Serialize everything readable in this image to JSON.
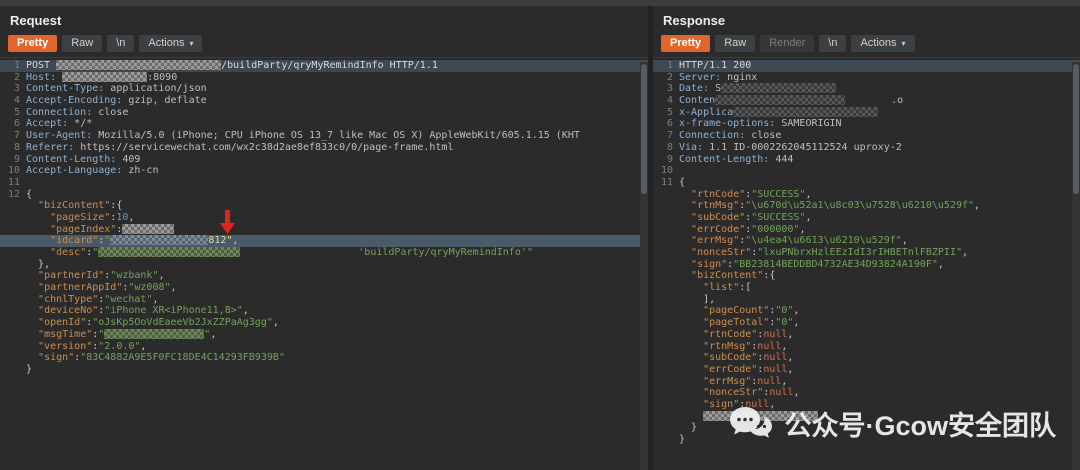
{
  "colors": {
    "accent_orange": "#e2662c",
    "selection_row": "#4b5a68",
    "caret_line": "#3e4852",
    "arrow_red": "#e0241a",
    "editor_bg": "#2b2b2b",
    "json_key": "#cd8d4e",
    "json_string": "#74a35a",
    "header_name_blue": "#8cb1d3"
  },
  "watermark": {
    "icon": "chat-bubbles-icon",
    "text": "公众号·Gcow安全团队"
  },
  "request": {
    "title": "Request",
    "tabs": [
      {
        "id": "pretty",
        "label": "Pretty",
        "selected": true
      },
      {
        "id": "raw",
        "label": "Raw"
      },
      {
        "id": "newline",
        "label": "\\n"
      },
      {
        "id": "actions",
        "label": "Actions",
        "caret": true
      }
    ],
    "lines": [
      {
        "n": "1",
        "hl": "caret",
        "seg": [
          [
            "t",
            "POST "
          ],
          [
            "R",
            165,
            "g"
          ],
          [
            "t",
            "/buildParty/qryMyRemindInfo HTTP/1.1"
          ]
        ]
      },
      {
        "n": "2",
        "seg": [
          [
            "h",
            "Host: "
          ],
          [
            "R",
            85,
            "g"
          ],
          [
            "v",
            ":8090"
          ]
        ]
      },
      {
        "n": "3",
        "seg": [
          [
            "h",
            "Content-Type: "
          ],
          [
            "v",
            "application/json"
          ]
        ]
      },
      {
        "n": "4",
        "seg": [
          [
            "h",
            "Accept-Encoding: "
          ],
          [
            "v",
            "gzip, deflate"
          ]
        ]
      },
      {
        "n": "5",
        "seg": [
          [
            "h",
            "Connection: "
          ],
          [
            "v",
            "close"
          ]
        ]
      },
      {
        "n": "6",
        "seg": [
          [
            "h",
            "Accept: "
          ],
          [
            "v",
            "*/*"
          ]
        ]
      },
      {
        "n": "7",
        "seg": [
          [
            "h",
            "User-Agent: "
          ],
          [
            "v",
            "Mozilla/5.0 (iPhone; CPU iPhone OS 13_7 like Mac OS X) AppleWebKit/605.1.15 (KHT"
          ]
        ]
      },
      {
        "n": "8",
        "seg": [
          [
            "h",
            "Referer: "
          ],
          [
            "v",
            "https://servicewechat.com/wx2c38d2ae8ef833c0/0/page-frame.html"
          ]
        ]
      },
      {
        "n": "9",
        "seg": [
          [
            "h",
            "Content-Length: "
          ],
          [
            "v",
            "409"
          ]
        ]
      },
      {
        "n": "10",
        "seg": [
          [
            "h",
            "Accept-Language: "
          ],
          [
            "v",
            "zh-cn"
          ]
        ]
      },
      {
        "n": "11",
        "seg": []
      },
      {
        "n": "12",
        "seg": [
          [
            "p",
            "{"
          ]
        ]
      },
      {
        "seg": [
          [
            "t",
            "  "
          ],
          [
            "k",
            "\"bizContent\""
          ],
          [
            "p",
            ":{"
          ]
        ]
      },
      {
        "seg": [
          [
            "t",
            "    "
          ],
          [
            "k",
            "\"pageSize\""
          ],
          [
            "p",
            ":"
          ],
          [
            "n",
            "10"
          ],
          [
            "p",
            ","
          ]
        ]
      },
      {
        "seg": [
          [
            "t",
            "    "
          ],
          [
            "k",
            "\"pageIndex\""
          ],
          [
            "p",
            ":"
          ],
          [
            "R",
            52,
            "g"
          ]
        ]
      },
      {
        "hl": "sel",
        "seg": [
          [
            "t",
            "    "
          ],
          [
            "k",
            "\"idcard\""
          ],
          [
            "p",
            ":"
          ],
          [
            "s",
            "\""
          ],
          [
            "R",
            98,
            "b"
          ],
          [
            "y",
            "812\""
          ],
          [
            "p",
            ","
          ]
        ]
      },
      {
        "seg": [
          [
            "t",
            "    "
          ],
          [
            "k",
            "\"desc\""
          ],
          [
            "p",
            ":"
          ],
          [
            "s",
            "\""
          ],
          [
            "R",
            142,
            "grn"
          ],
          [
            "S",
            118
          ],
          [
            "s",
            "'buildParty/qryMyRemindInfo'\""
          ]
        ]
      },
      {
        "seg": [
          [
            "t",
            "  "
          ],
          [
            "p",
            "},"
          ]
        ]
      },
      {
        "seg": [
          [
            "t",
            "  "
          ],
          [
            "k",
            "\"partnerId\""
          ],
          [
            "p",
            ":"
          ],
          [
            "s",
            "\"wzbank\""
          ],
          [
            "p",
            ","
          ]
        ]
      },
      {
        "seg": [
          [
            "t",
            "  "
          ],
          [
            "k",
            "\"partnerAppId\""
          ],
          [
            "p",
            ":"
          ],
          [
            "s",
            "\"wz008\""
          ],
          [
            "p",
            ","
          ]
        ]
      },
      {
        "seg": [
          [
            "t",
            "  "
          ],
          [
            "k",
            "\"chnlType\""
          ],
          [
            "p",
            ":"
          ],
          [
            "s",
            "\"wechat\""
          ],
          [
            "p",
            ","
          ]
        ]
      },
      {
        "seg": [
          [
            "t",
            "  "
          ],
          [
            "k",
            "\"deviceNo\""
          ],
          [
            "p",
            ":"
          ],
          [
            "s",
            "\"iPhone XR<iPhone11,8>\""
          ],
          [
            "p",
            ","
          ]
        ]
      },
      {
        "seg": [
          [
            "t",
            "  "
          ],
          [
            "k",
            "\"openId\""
          ],
          [
            "p",
            ":"
          ],
          [
            "s",
            "\"oJsKp5OoVdEaeeVb2JxZZPaAg3gg\""
          ],
          [
            "p",
            ","
          ]
        ]
      },
      {
        "seg": [
          [
            "t",
            "  "
          ],
          [
            "k",
            "\"msgTime\""
          ],
          [
            "p",
            ":"
          ],
          [
            "s",
            "\""
          ],
          [
            "R",
            100,
            "grn"
          ],
          [
            "s",
            "\""
          ],
          [
            "p",
            ","
          ]
        ]
      },
      {
        "seg": [
          [
            "t",
            "  "
          ],
          [
            "k",
            "\"version\""
          ],
          [
            "p",
            ":"
          ],
          [
            "s",
            "\"2.0.0\""
          ],
          [
            "p",
            ","
          ]
        ]
      },
      {
        "seg": [
          [
            "t",
            "  "
          ],
          [
            "k",
            "\"sign\""
          ],
          [
            "p",
            ":"
          ],
          [
            "s",
            "\"83C4882A9E5F0FC18DE4C14293FB939B\""
          ]
        ]
      },
      {
        "seg": [
          [
            "p",
            "}"
          ]
        ]
      }
    ]
  },
  "response": {
    "title": "Response",
    "tabs": [
      {
        "id": "pretty",
        "label": "Pretty",
        "selected": true
      },
      {
        "id": "raw",
        "label": "Raw"
      },
      {
        "id": "render",
        "label": "Render",
        "disabled": true
      },
      {
        "id": "newline",
        "label": "\\n"
      },
      {
        "id": "actions",
        "label": "Actions",
        "caret": true
      }
    ],
    "lines": [
      {
        "n": "1",
        "hl": "caret",
        "seg": [
          [
            "t",
            "HTTP/1.1 200"
          ]
        ]
      },
      {
        "n": "2",
        "seg": [
          [
            "h",
            "Server: "
          ],
          [
            "v",
            "nginx"
          ]
        ]
      },
      {
        "n": "3",
        "seg": [
          [
            "h",
            "Date: "
          ],
          [
            "v",
            "S"
          ],
          [
            "R",
            115,
            "d"
          ]
        ]
      },
      {
        "n": "4",
        "seg": [
          [
            "h",
            "Conten"
          ],
          [
            "R",
            130,
            "d"
          ],
          [
            "S",
            46
          ],
          [
            "v",
            ".o"
          ]
        ]
      },
      {
        "n": "5",
        "seg": [
          [
            "h",
            "x-Applica"
          ],
          [
            "R",
            145,
            "d"
          ]
        ]
      },
      {
        "n": "6",
        "seg": [
          [
            "h",
            "x-frame-options: "
          ],
          [
            "v",
            "SAMEORIGIN"
          ]
        ]
      },
      {
        "n": "7",
        "seg": [
          [
            "h",
            "Connection: "
          ],
          [
            "v",
            "close"
          ]
        ]
      },
      {
        "n": "8",
        "seg": [
          [
            "h",
            "Via: "
          ],
          [
            "v",
            "1.1 ID-0002262045112524 uproxy-2"
          ]
        ]
      },
      {
        "n": "9",
        "seg": [
          [
            "h",
            "Content-Length: "
          ],
          [
            "v",
            "444"
          ]
        ]
      },
      {
        "n": "10",
        "seg": []
      },
      {
        "n": "11",
        "seg": [
          [
            "p",
            "{"
          ]
        ]
      },
      {
        "seg": [
          [
            "t",
            "  "
          ],
          [
            "k",
            "\"rtnCode\""
          ],
          [
            "p",
            ":"
          ],
          [
            "s",
            "\"SUCCESS\""
          ],
          [
            "p",
            ","
          ]
        ]
      },
      {
        "seg": [
          [
            "t",
            "  "
          ],
          [
            "k",
            "\"rtnMsg\""
          ],
          [
            "p",
            ":"
          ],
          [
            "s",
            "\"\\u670d\\u52a1\\u8c03\\u7528\\u6210\\u529f\""
          ],
          [
            "p",
            ","
          ]
        ]
      },
      {
        "seg": [
          [
            "t",
            "  "
          ],
          [
            "k",
            "\"subCode\""
          ],
          [
            "p",
            ":"
          ],
          [
            "s",
            "\"SUCCESS\""
          ],
          [
            "p",
            ","
          ]
        ]
      },
      {
        "seg": [
          [
            "t",
            "  "
          ],
          [
            "k",
            "\"errCode\""
          ],
          [
            "p",
            ":"
          ],
          [
            "s",
            "\"000000\""
          ],
          [
            "p",
            ","
          ]
        ]
      },
      {
        "seg": [
          [
            "t",
            "  "
          ],
          [
            "k",
            "\"errMsg\""
          ],
          [
            "p",
            ":"
          ],
          [
            "s",
            "\"\\u4ea4\\u6613\\u6210\\u529f\""
          ],
          [
            "p",
            ","
          ]
        ]
      },
      {
        "seg": [
          [
            "t",
            "  "
          ],
          [
            "k",
            "\"nonceStr\""
          ],
          [
            "p",
            ":"
          ],
          [
            "s",
            "\"lxuPNbrxHzlEEzIdI3rIHBETnlFBZPII\""
          ],
          [
            "p",
            ","
          ]
        ]
      },
      {
        "seg": [
          [
            "t",
            "  "
          ],
          [
            "k",
            "\"sign\""
          ],
          [
            "p",
            ":"
          ],
          [
            "s",
            "\"BB23814BEDDBD4732AE34D93824A190F\""
          ],
          [
            "p",
            ","
          ]
        ]
      },
      {
        "seg": [
          [
            "t",
            "  "
          ],
          [
            "k",
            "\"bizContent\""
          ],
          [
            "p",
            ":{"
          ]
        ]
      },
      {
        "seg": [
          [
            "t",
            "    "
          ],
          [
            "k",
            "\"list\""
          ],
          [
            "p",
            ":["
          ]
        ]
      },
      {
        "seg": [
          [
            "t",
            "    "
          ],
          [
            "p",
            "],"
          ]
        ]
      },
      {
        "seg": [
          [
            "t",
            "    "
          ],
          [
            "k",
            "\"pageCount\""
          ],
          [
            "p",
            ":"
          ],
          [
            "s",
            "\"0\""
          ],
          [
            "p",
            ","
          ]
        ]
      },
      {
        "seg": [
          [
            "t",
            "    "
          ],
          [
            "k",
            "\"pageTotal\""
          ],
          [
            "p",
            ":"
          ],
          [
            "s",
            "\"0\""
          ],
          [
            "p",
            ","
          ]
        ]
      },
      {
        "seg": [
          [
            "t",
            "    "
          ],
          [
            "k",
            "\"rtnCode\""
          ],
          [
            "p",
            ":"
          ],
          [
            "u",
            "null"
          ],
          [
            "p",
            ","
          ]
        ]
      },
      {
        "seg": [
          [
            "t",
            "    "
          ],
          [
            "k",
            "\"rtnMsg\""
          ],
          [
            "p",
            ":"
          ],
          [
            "u",
            "null"
          ],
          [
            "p",
            ","
          ]
        ]
      },
      {
        "seg": [
          [
            "t",
            "    "
          ],
          [
            "k",
            "\"subCode\""
          ],
          [
            "p",
            ":"
          ],
          [
            "u",
            "null"
          ],
          [
            "p",
            ","
          ]
        ]
      },
      {
        "seg": [
          [
            "t",
            "    "
          ],
          [
            "k",
            "\"errCode\""
          ],
          [
            "p",
            ":"
          ],
          [
            "u",
            "null"
          ],
          [
            "p",
            ","
          ]
        ]
      },
      {
        "seg": [
          [
            "t",
            "    "
          ],
          [
            "k",
            "\"errMsg\""
          ],
          [
            "p",
            ":"
          ],
          [
            "u",
            "null"
          ],
          [
            "p",
            ","
          ]
        ]
      },
      {
        "seg": [
          [
            "t",
            "    "
          ],
          [
            "k",
            "\"nonceStr\""
          ],
          [
            "p",
            ":"
          ],
          [
            "u",
            "null"
          ],
          [
            "p",
            ","
          ]
        ]
      },
      {
        "seg": [
          [
            "t",
            "    "
          ],
          [
            "k",
            "\"sign\""
          ],
          [
            "p",
            ":"
          ],
          [
            "u",
            "null"
          ],
          [
            "p",
            ","
          ]
        ]
      },
      {
        "seg": [
          [
            "t",
            "    "
          ],
          [
            "R",
            115,
            "g"
          ]
        ]
      },
      {
        "seg": [
          [
            "t",
            "  "
          ],
          [
            "p",
            "}"
          ]
        ]
      },
      {
        "seg": [
          [
            "p",
            "}"
          ]
        ]
      }
    ]
  }
}
